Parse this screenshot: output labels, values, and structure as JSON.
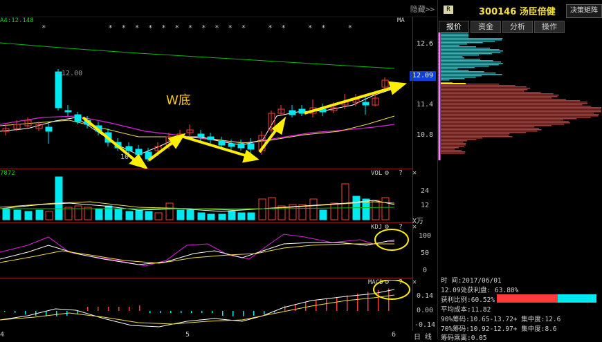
{
  "header": {
    "hide_label": "隐藏>>"
  },
  "main_chart": {
    "ma_line": "A4:12.148",
    "ma_label": "MA",
    "stars": "*         * * * * * * * * * * *   * *   * *   *",
    "high_label": "←12.00",
    "low_label": "10.",
    "annotation": "W底",
    "axis_ticks": [
      "12.6",
      "11.4",
      "10.8"
    ],
    "current_price": "12.09"
  },
  "volume_pane": {
    "header": "7872",
    "title": "VOL",
    "icons": "⚙ ? ✕",
    "axis_ticks": [
      "24",
      "12"
    ],
    "unit": "X万"
  },
  "kdj_pane": {
    "title": "KDJ",
    "icons": "⚙ ? ✕",
    "axis_ticks": [
      "100",
      "50",
      "0"
    ]
  },
  "macd_pane": {
    "title": "MACD",
    "icons": "⚙ ? ✕",
    "axis_ticks": [
      "0.14",
      "0.00",
      "-0.14"
    ]
  },
  "bottom_axis": {
    "labels": [
      "4",
      "5",
      "6"
    ],
    "right_label": "日 线"
  },
  "right_panel": {
    "badge": "R",
    "stock_title": "300146 汤臣倍健",
    "decision_btn": "决策矩阵",
    "tabs": [
      "报价",
      "资金",
      "分析",
      "操作"
    ],
    "active_tab": 0,
    "chip_axis": [
      "12.6",
      "11.4",
      "10.8"
    ],
    "current_price": "12.09",
    "info": {
      "time": "时     间:2017/06/01",
      "profit_at": "12.09处获利盘: 63.80%",
      "profit_ratio": "获利比例:60.52%",
      "avg_cost": "平均成本:11.82",
      "chip90": "90%筹码:10.65-13.72+ 集中度:12.6",
      "chip70": "70%筹码:10.92-12.97+ 集中度:8.6",
      "chip_mult": "筹码乘离:0.05"
    },
    "profit_bar": {
      "red_fraction": 0.6052
    }
  },
  "colors": {
    "up": "#ff3a3a",
    "down": "#00e8f0",
    "ma_white": "#ffffff",
    "ma_yellow": "#f5e040",
    "ma_magenta": "#e020e0",
    "ma_green": "#00c000",
    "arrow": "#ffee00",
    "current": "#1040d8"
  }
}
